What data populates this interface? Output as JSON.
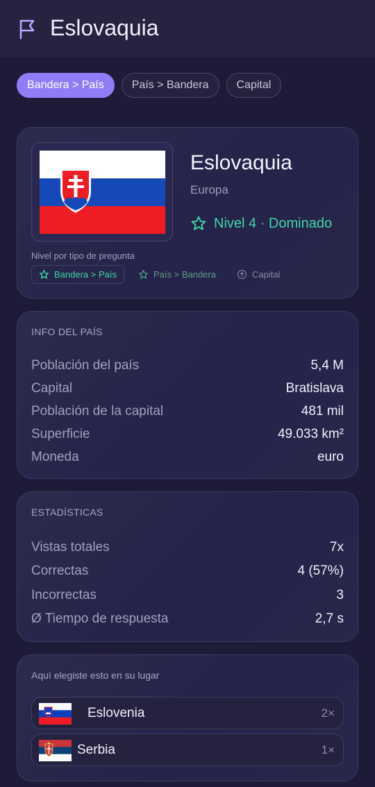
{
  "header": {
    "title": "Eslovaquia",
    "icon": "flag-icon"
  },
  "mode_tabs": [
    {
      "label": "Bandera > País",
      "active": true
    },
    {
      "label": "País > Bandera",
      "active": false
    },
    {
      "label": "Capital",
      "active": false
    }
  ],
  "country": {
    "name": "Eslovaquia",
    "continent": "Europa",
    "level_text": "Nivel 4 · Dominado",
    "level_caption": "Nivel por tipo de pregunta",
    "per_type": [
      {
        "label": "Bandera > País",
        "icon": "star-icon"
      },
      {
        "label": "País > Bandera",
        "icon": "star-icon"
      },
      {
        "label": "Capital",
        "icon": "arrow-up-circle-icon"
      }
    ]
  },
  "info": {
    "heading": "INFO DEL PAÍS",
    "rows": [
      {
        "key": "Población del país",
        "value": "5,4 M"
      },
      {
        "key": "Capital",
        "value": "Bratislava"
      },
      {
        "key": "Población de la capital",
        "value": "481 mil"
      },
      {
        "key": "Superficie",
        "value": "49.033 km²"
      },
      {
        "key": "Moneda",
        "value": "euro"
      }
    ]
  },
  "stats": {
    "heading": "ESTADÍSTICAS",
    "rows": [
      {
        "key": "Vistas totales",
        "value": "7x"
      },
      {
        "key": "Correctas",
        "value": "4 (57%)"
      },
      {
        "key": "Incorrectas",
        "value": "3"
      },
      {
        "key": "Ø Tiempo de respuesta",
        "value": "2,7 s"
      }
    ]
  },
  "alternatives": {
    "heading": "Aquí elegiste esto en su lugar",
    "items": [
      {
        "name": "Eslovenia",
        "count": "2×"
      },
      {
        "name": "Serbia",
        "count": "1×"
      }
    ]
  },
  "colors": {
    "accent": "#8f7df7",
    "mastered": "#3fd6a6",
    "background": "#1d1b38"
  }
}
